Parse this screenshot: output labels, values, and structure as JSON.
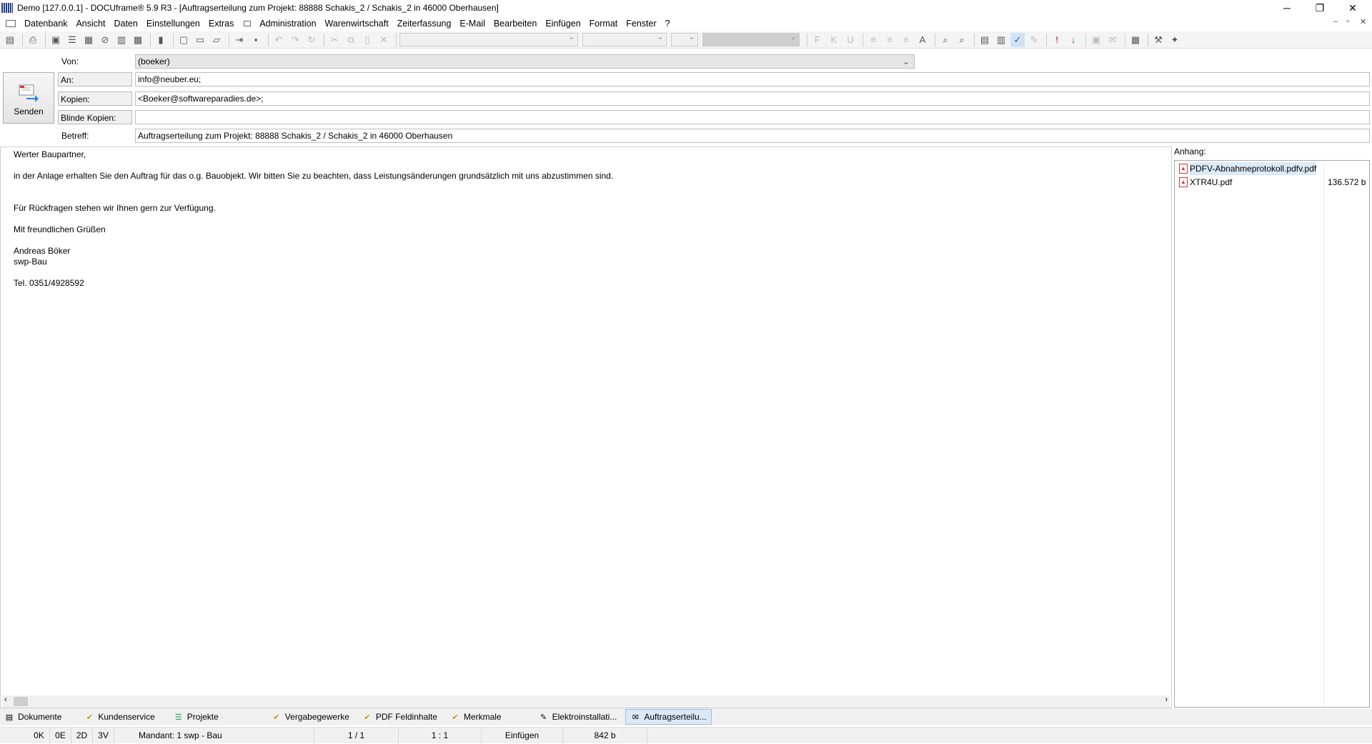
{
  "window": {
    "title": "Demo [127.0.0.1] - DOCUframe® 5.9 R3 - [Auftragserteilung zum Projekt: 88888 Schakis_2 / Schakis_2 in 46000 Oberhausen]",
    "minimize": "─",
    "restore": "❐",
    "close": "✕",
    "mdi_minimize": "–",
    "mdi_restore": "▫",
    "mdi_close": "✕"
  },
  "menu": [
    "Datenbank",
    "Ansicht",
    "Daten",
    "Einstellungen",
    "Extras",
    "Administration",
    "Warenwirtschaft",
    "Zeiterfassung",
    "E-Mail",
    "Bearbeiten",
    "Einfügen",
    "Format",
    "Fenster",
    "?"
  ],
  "toolbar": {
    "format_buttons": [
      "F",
      "K",
      "U"
    ],
    "font_color_label": "A"
  },
  "header": {
    "von_label": "Von:",
    "von_value": "(boeker)",
    "an_label": "An:",
    "an_value": "info@neuber.eu;",
    "kopien_label": "Kopien:",
    "kopien_value": "<Boeker@softwareparadies.de>;",
    "blinde_label": "Blinde Kopien:",
    "blinde_value": "",
    "betreff_label": "Betreff:",
    "betreff_value": "Auftragserteilung zum Projekt: 88888 Schakis_2 / Schakis_2 in 46000 Oberhausen",
    "send_label": "Senden"
  },
  "body": {
    "greeting": "Werter Baupartner,",
    "line1": "in der Anlage erhalten Sie den Auftrag für das o.g. Bauobjekt. Wir bitten Sie zu beachten, dass Leistungsänderungen grundsätzlich mit uns abzustimmen sind.",
    "line2": "Für Rückfragen stehen wir Ihnen gern zur Verfügung.",
    "closing": "Mit freundlichen Grüßen",
    "name": "Andreas Böker",
    "company": "swp-Bau",
    "phone": "Tel. 0351/4928592"
  },
  "attachments": {
    "label": "Anhang:",
    "items": [
      {
        "name": "PDFV-Abnahmeprotokoll.pdfv.pdf",
        "size": ""
      },
      {
        "name": "XTR4U.pdf",
        "size": "136.572 b"
      }
    ]
  },
  "tabs": [
    "Dokumente",
    "Kundenservice",
    "Projekte",
    "Vergabegewerke",
    "PDF Feldinhalte",
    "Merkmale",
    "Elektroinstallati...",
    "Auftragserteilu..."
  ],
  "status": {
    "s1": "0K",
    "s2": "0E",
    "s3": "2D",
    "s4": "3V",
    "mandant": "Mandant: 1 swp - Bau",
    "page": "1 / 1",
    "ratio": "1 : 1",
    "mode": "Einfügen",
    "size": "842 b"
  },
  "colors": {
    "accent": "#0078d7",
    "pdf": "#d33333",
    "tab_active": "#dbe9f7"
  }
}
